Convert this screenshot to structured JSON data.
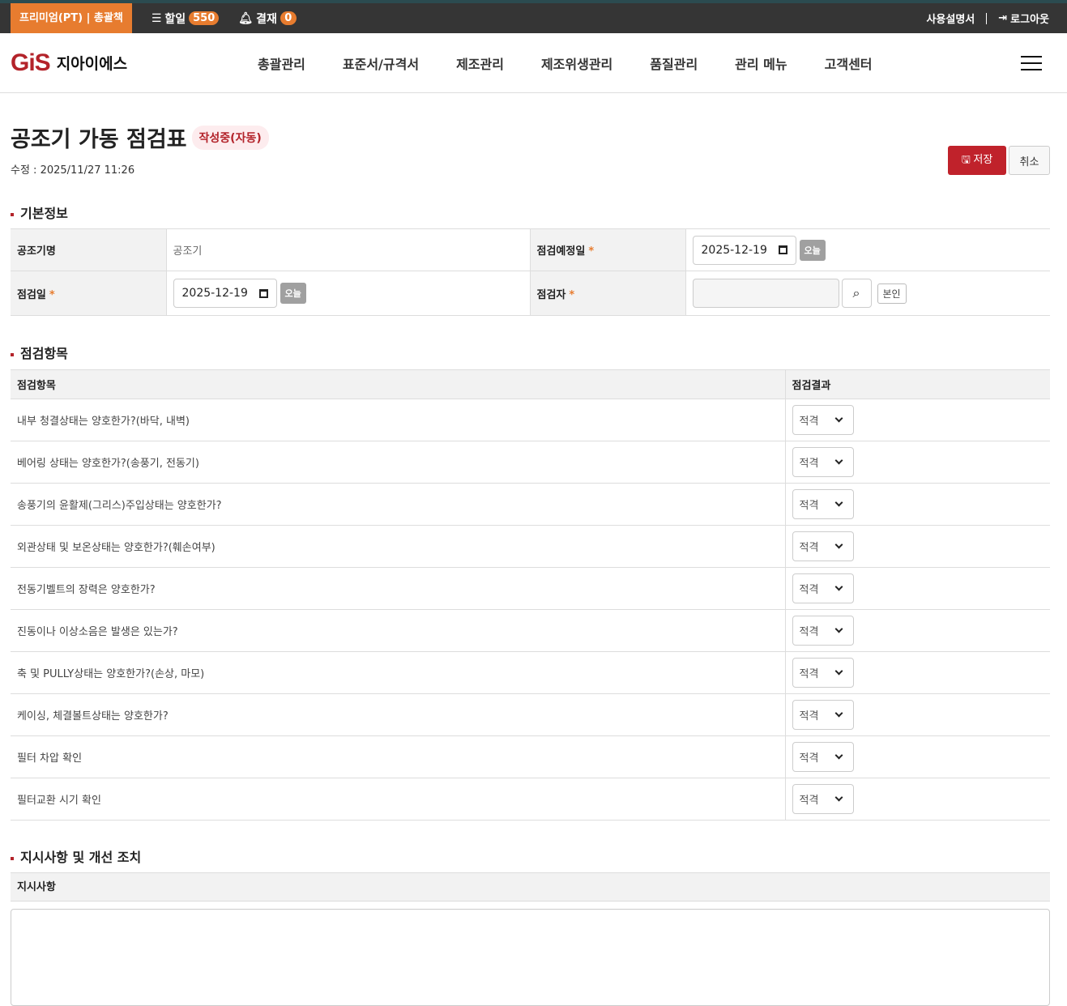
{
  "topbar": {
    "brand": "프리미엄(PT) | 총괄책",
    "todo_label": "할일",
    "todo_count": "550",
    "approval_label": "결재",
    "approval_count": "0",
    "manual": "사용설명서",
    "logout": "로그아웃"
  },
  "nav": {
    "logo_mark": "GiS",
    "logo_text": "지아이에스",
    "menu": [
      "총괄관리",
      "표준서/규격서",
      "제조관리",
      "제조위생관리",
      "품질관리",
      "관리 메뉴",
      "고객센터"
    ]
  },
  "page": {
    "title": "공조기 가동 점검표",
    "status": "작성중(자동)",
    "modified": "수정 : 2025/11/27 11:26",
    "save": "저장",
    "cancel": "취소"
  },
  "basic": {
    "heading": "기본정보",
    "name_label": "공조기명",
    "name_value": "공조기",
    "planned_label": "점검예정일",
    "planned_date": "2025-12-19",
    "date_label": "점검일",
    "date_value": "2025-12-19",
    "today": "오늘",
    "inspector_label": "점검자",
    "inspector_value": "",
    "self": "본인",
    "required": "*"
  },
  "items": {
    "heading": "점검항목",
    "col_item": "점검항목",
    "col_result": "점검결과",
    "rows": [
      {
        "q": "내부 청결상태는 양호한가?(바닥, 내벽)",
        "r": "적격"
      },
      {
        "q": "베어링 상태는 양호한가?(송풍기, 전동기)",
        "r": "적격"
      },
      {
        "q": "송풍기의 윤활제(그리스)주입상태는 양호한가?",
        "r": "적격"
      },
      {
        "q": "외관상태 및 보온상태는 양호한가?(훼손여부)",
        "r": "적격"
      },
      {
        "q": "전동기벨트의 장력은 양호한가?",
        "r": "적격"
      },
      {
        "q": "진동이나 이상소음은 발생은 있는가?",
        "r": "적격"
      },
      {
        "q": "축 및 PULLY상태는 양호한가?(손상, 마모)",
        "r": "적격"
      },
      {
        "q": "케이싱, 체결볼트상태는 양호한가?",
        "r": "적격"
      },
      {
        "q": "필터 차압 확인",
        "r": "적격"
      },
      {
        "q": "필터교환 시기 확인",
        "r": "적격"
      }
    ]
  },
  "instructions": {
    "heading": "지시사항 및 개선 조치",
    "label": "지시사항",
    "value": ""
  }
}
